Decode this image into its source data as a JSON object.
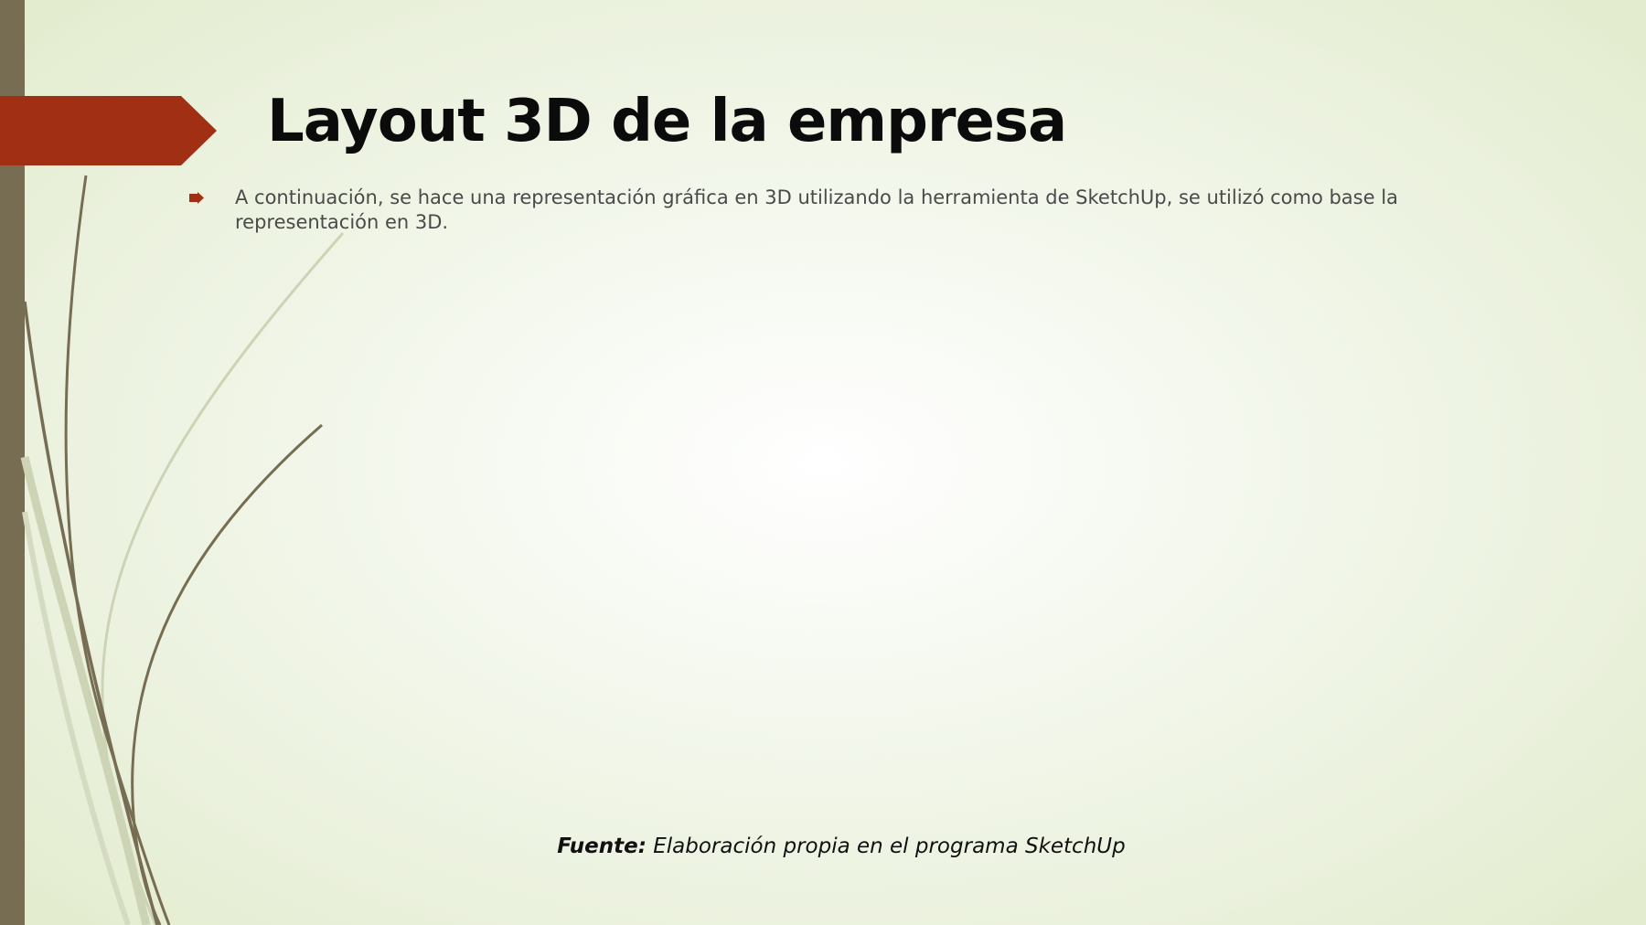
{
  "slide": {
    "title": "Layout 3D de la empresa",
    "bullets": [
      {
        "text": "A continuación, se hace una representación gráfica en 3D utilizando la herramienta de SketchUp, se utilizó como base la representación en 3D."
      }
    ],
    "source": {
      "label": "Fuente:",
      "text": "Elaboración propia en el programa SketchUp"
    }
  },
  "colors": {
    "accent": "#a02f14",
    "sidebar": "#766d52",
    "curve_dark": "#766d52",
    "curve_light": "#cdd4b6",
    "background_center": "#ffffff",
    "background_edge": "#e2ebcc"
  },
  "icons": {
    "bullet": "arrow-bullet-icon",
    "title_banner": "arrow-banner-shape"
  }
}
